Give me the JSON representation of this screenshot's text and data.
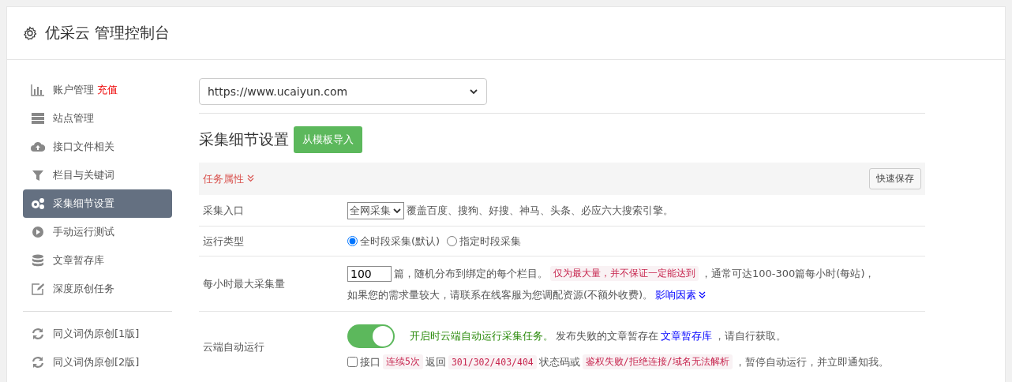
{
  "header": {
    "title": "优采云 管理控制台"
  },
  "sidebar": {
    "groups": [
      [
        {
          "kind": "chart",
          "label": "账户管理",
          "badge": "充值",
          "selected": false
        },
        {
          "kind": "server",
          "label": "站点管理",
          "selected": false
        },
        {
          "kind": "cloud",
          "label": "接口文件相关",
          "selected": false
        },
        {
          "kind": "filter",
          "label": "栏目与关键词",
          "selected": false
        },
        {
          "kind": "gears",
          "label": "采集细节设置",
          "selected": true
        },
        {
          "kind": "play",
          "label": "手动运行测试",
          "selected": false
        },
        {
          "kind": "database",
          "label": "文章暂存库",
          "selected": false
        },
        {
          "kind": "edit",
          "label": "深度原创任务",
          "selected": false
        }
      ],
      [
        {
          "kind": "refresh",
          "label": "同义词伪原创[1版]",
          "selected": false
        },
        {
          "kind": "refresh",
          "label": "同义词伪原创[2版]",
          "selected": false
        }
      ]
    ]
  },
  "site_select": {
    "value": "https://www.ucaiyun.com"
  },
  "section": {
    "title": "采集细节设置",
    "import_button": "从模板导入"
  },
  "panel": {
    "title": "任务属性",
    "expanded": true,
    "save_button": "快速保存"
  },
  "rows": [
    {
      "kind": "entry",
      "label": "采集入口",
      "select": "全网采集",
      "text": "覆盖百度、搜狗、好搜、神马、头条、必应六大搜索引擎。"
    },
    {
      "kind": "radios",
      "label": "运行类型",
      "options": [
        {
          "label": "全时段采集(默认)",
          "selected": true
        },
        {
          "label": "指定时段采集",
          "selected": false
        }
      ]
    },
    {
      "kind": "hourly",
      "label": "每小时最大采集量",
      "value": "100",
      "text1": "篇，随机分布到绑定的每个栏目。",
      "note": "仅为最大量，并不保证一定能达到",
      "text2": "，通常可达100-300篇每小时(每站)，",
      "text3": "如果您的需求量较大，请联系在线客服为您调配资源(不额外收费)。",
      "link": "影响因素"
    },
    {
      "kind": "cloud",
      "label": "云端自动运行",
      "on": true,
      "green": "开启时云端自动运行采集任务。",
      "text1": "发布失败的文章暂存在",
      "link": "文章暂存库",
      "text2": "，请自行获取。",
      "check": {
        "checked": false,
        "parts": [
          {
            "kind": "plain",
            "text": "接口"
          },
          {
            "kind": "code",
            "text": "连续5次"
          },
          {
            "kind": "plain",
            "text": "返回"
          },
          {
            "kind": "code",
            "text": "301/302/403/404"
          },
          {
            "kind": "plain",
            "text": "状态码或"
          },
          {
            "kind": "code",
            "text": "鉴权失败/拒绝连接/域名无法解析"
          },
          {
            "kind": "plain",
            "text": "，暂停自动运行，并立即通知我。"
          }
        ]
      }
    }
  ]
}
